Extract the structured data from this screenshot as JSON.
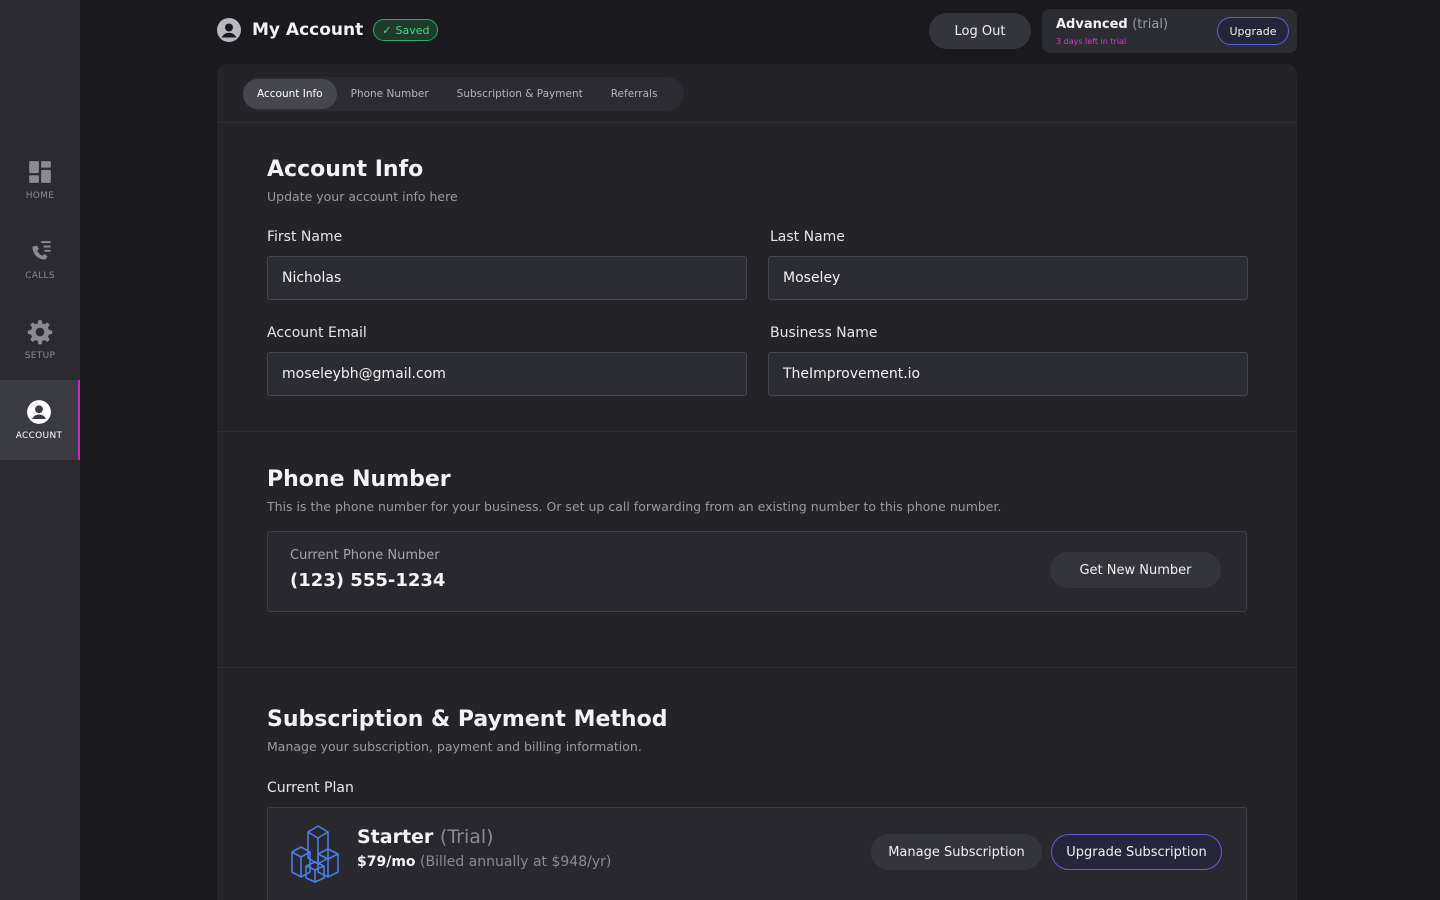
{
  "sidebar": {
    "items": [
      {
        "label": "HOME"
      },
      {
        "label": "CALLS"
      },
      {
        "label": "SETUP"
      },
      {
        "label": "ACCOUNT"
      }
    ]
  },
  "header": {
    "title": "My Account",
    "saved_badge": "Saved",
    "logout_label": "Log Out",
    "plan": {
      "name": "Advanced",
      "status": "(trial)",
      "days_left": "3 days left in trial",
      "upgrade_label": "Upgrade"
    }
  },
  "tabs": [
    {
      "label": "Account Info"
    },
    {
      "label": "Phone Number"
    },
    {
      "label": "Subscription & Payment"
    },
    {
      "label": "Referrals"
    }
  ],
  "account_info": {
    "title": "Account Info",
    "subtitle": "Update your account info here",
    "first_name_label": "First Name",
    "first_name_value": "Nicholas",
    "last_name_label": "Last Name",
    "last_name_value": "Moseley",
    "email_label": "Account Email",
    "email_value": "moseleybh@gmail.com",
    "business_label": "Business Name",
    "business_value": "TheImprovement.io"
  },
  "phone_number": {
    "title": "Phone Number",
    "subtitle": "This is the phone number for your business. Or set up call forwarding from an existing number to this phone number.",
    "current_label": "Current Phone Number",
    "current_value": "(123) 555-1234",
    "get_new_label": "Get New Number"
  },
  "subscription": {
    "title": "Subscription & Payment Method",
    "subtitle": "Manage your subscription, payment and billing information.",
    "current_plan_label": "Current Plan",
    "plan_name": "Starter",
    "plan_status": "(Trial)",
    "price": "$79/mo",
    "billing_note": "(Billed annually at $948/yr)",
    "manage_label": "Manage Subscription",
    "upgrade_label": "Upgrade Subscription"
  },
  "colors": {
    "accent_pink": "#d026b8",
    "accent_blue": "#4a7ee8",
    "saved_green": "#4cd88a"
  }
}
